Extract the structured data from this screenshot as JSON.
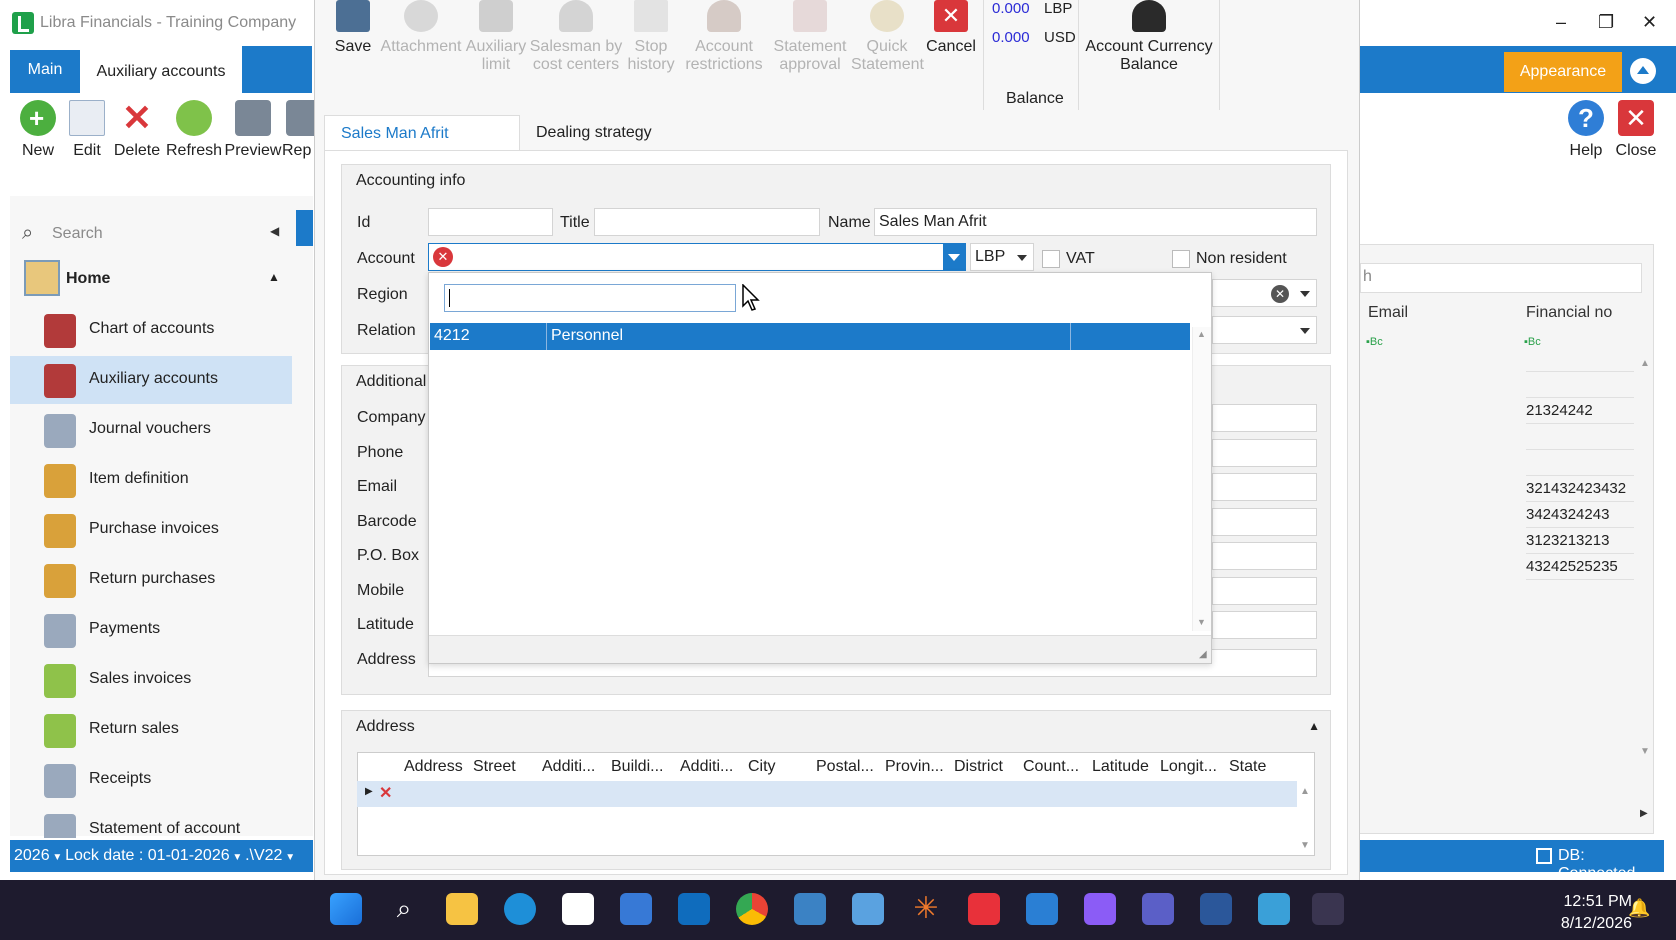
{
  "window": {
    "title": "Libra Financials - Training Company",
    "controls": [
      "–",
      "❐",
      "✕"
    ]
  },
  "ribbon": {
    "tabs": [
      "Main",
      "Auxiliary accounts"
    ],
    "tools": [
      "New",
      "Edit",
      "Delete",
      "Refresh",
      "Preview",
      "Rep"
    ],
    "appearance": "Appearance",
    "help": "Help",
    "close": "Close"
  },
  "nav": {
    "search_placeholder": "Search",
    "home": "Home",
    "items": [
      "Chart of accounts",
      "Auxiliary accounts",
      "Journal vouchers",
      "Item definition",
      "Purchase invoices",
      "Return purchases",
      "Payments",
      "Sales invoices",
      "Return sales",
      "Receipts",
      "Statement of account"
    ],
    "active_index": 1
  },
  "status": {
    "year": "2026",
    "lock": "Lock date : 01-01-2026",
    "version": ".\\V22",
    "db": "DB: Connected"
  },
  "right_grid": {
    "search_value": "h",
    "columns": [
      "Email",
      "Financial no"
    ],
    "financial_no": [
      "",
      "",
      "21324242",
      "",
      "",
      "321432423432",
      "3424324243",
      "3123213213",
      "43242525235"
    ]
  },
  "modal": {
    "toolbar": {
      "save": "Save",
      "attachment": "Attachment",
      "aux_limit_1": "Auxiliary",
      "aux_limit_2": "limit",
      "salesman_1": "Salesman by",
      "salesman_2": "cost centers",
      "stop_1": "Stop",
      "stop_2": "history",
      "acct_1": "Account",
      "acct_2": "restrictions",
      "stmt_1": "Statement",
      "stmt_2": "approval",
      "quick_1": "Quick",
      "quick_2": "Statement",
      "cancel": "Cancel",
      "balance_lbp_value": "0.000",
      "balance_lbp_currency": "LBP",
      "balance_usd_value": "0.000",
      "balance_usd_currency": "USD",
      "balance_label": "Balance",
      "acb_1": "Account Currency",
      "acb_2": "Balance"
    },
    "tabs": [
      "Sales Man Afrit",
      "Dealing strategy"
    ],
    "accounting_info": {
      "header": "Accounting info",
      "id_label": "Id",
      "id_value": "",
      "title_label": "Title",
      "title_value": "",
      "name_label": "Name",
      "name_value": "Sales Man Afrit",
      "account_label": "Account",
      "currency": "LBP",
      "vat_label": "VAT",
      "non_resident_label": "Non resident",
      "region_label": "Region",
      "relation_label": "Relation"
    },
    "account_dropdown": {
      "search_value": "",
      "rows": [
        {
          "code": "4212",
          "name": "Personnel"
        }
      ]
    },
    "additional": {
      "header": "Additional",
      "labels": [
        "Company",
        "Phone",
        "Email",
        "Barcode",
        "P.O. Box",
        "Mobile",
        "Latitude",
        "Address"
      ]
    },
    "address": {
      "header": "Address",
      "columns": [
        "Address",
        "Street",
        "Additi...",
        "Buildi...",
        "Additi...",
        "City",
        "Postal...",
        "Provin...",
        "District",
        "Count...",
        "Latitude",
        "Longit...",
        "State"
      ]
    }
  },
  "taskbar": {
    "time": "12:51 PM",
    "date": "8/12/2026"
  },
  "colors": {
    "accent": "#1c7ac9",
    "appearance": "#f3a117",
    "danger": "#d9373b",
    "taskbar": "#1e1b2e"
  }
}
